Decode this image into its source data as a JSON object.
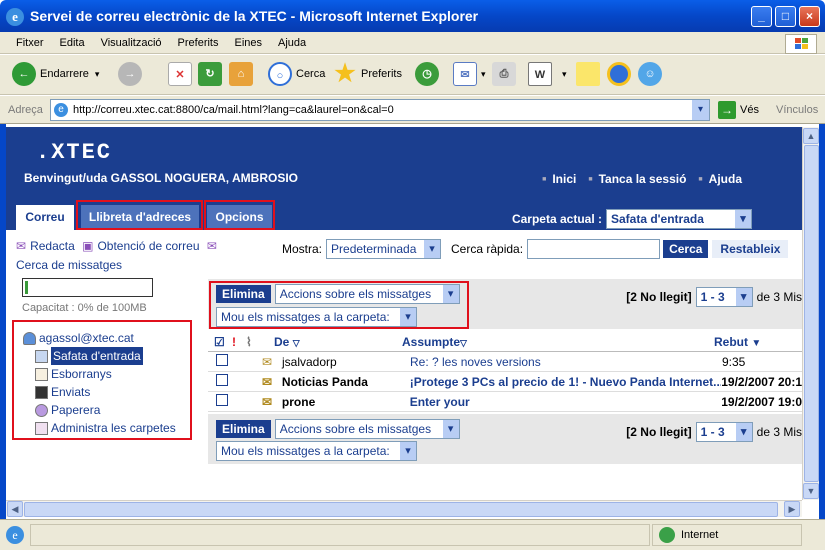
{
  "window": {
    "title": "Servei de correu electrònic de la XTEC - Microsoft Internet Explorer"
  },
  "menu": [
    "Fitxer",
    "Edita",
    "Visualització",
    "Preferits",
    "Eines",
    "Ajuda"
  ],
  "toolbar": {
    "back": "Endarrere",
    "search": "Cerca",
    "favorites": "Preferits"
  },
  "address": {
    "label": "Adreça",
    "url": "http://correu.xtec.cat:8800/ca/mail.html?lang=ca&laurel=on&cal=0",
    "go": "Vés",
    "links": "Vínculos"
  },
  "header": {
    "logo": ".XTEC",
    "welcome": "Benvingut/uda GASSOL NOGUERA, AMBROSIO",
    "links": [
      "Inici",
      "Tanca la sessió",
      "Ajuda"
    ],
    "tabs": [
      "Correu",
      "Llibreta d'adreces",
      "Opcions"
    ],
    "current_folder_label": "Carpeta actual :",
    "current_folder_value": "Safata d'entrada"
  },
  "left": {
    "compose": "Redacta",
    "get_mail": "Obtenció de correu",
    "search_messages": "Cerca de missatges",
    "quota_label": "Capacitat : 0% de 100MB",
    "quota_fraction": 0.01,
    "account": "agassol@xtec.cat",
    "folders": [
      "Safata d'entrada",
      "Esborranys",
      "Enviats",
      "Paperera",
      "Administra les carpetes"
    ]
  },
  "search": {
    "show_label": "Mostra:",
    "show_value": "Predeterminada",
    "quick_label": "Cerca ràpida:",
    "search_btn": "Cerca",
    "reset_btn": "Restableix"
  },
  "actions": {
    "delete": "Elimina",
    "actions_select": "Accions sobre els missatges",
    "move_select": "Mou els missatges a la carpeta:",
    "unread": "[2 No llegit]",
    "range": "1 - 3",
    "of": "de 3 Mis"
  },
  "table": {
    "col_from": "De",
    "col_subject": "Assumpte",
    "col_date": "Rebut",
    "rows": [
      {
        "from": "jsalvadorp",
        "subject": "Re: ? les noves versions",
        "date": "9:35"
      },
      {
        "from": "Noticias Panda",
        "subject": "¡Protege 3 PCs al precio de 1! - Nuevo Panda Internet...",
        "date": "19/2/2007 20:1"
      },
      {
        "from": "prone",
        "subject": "Enter your",
        "date": "19/2/2007 19:0"
      }
    ]
  },
  "status": {
    "zone": "Internet"
  }
}
